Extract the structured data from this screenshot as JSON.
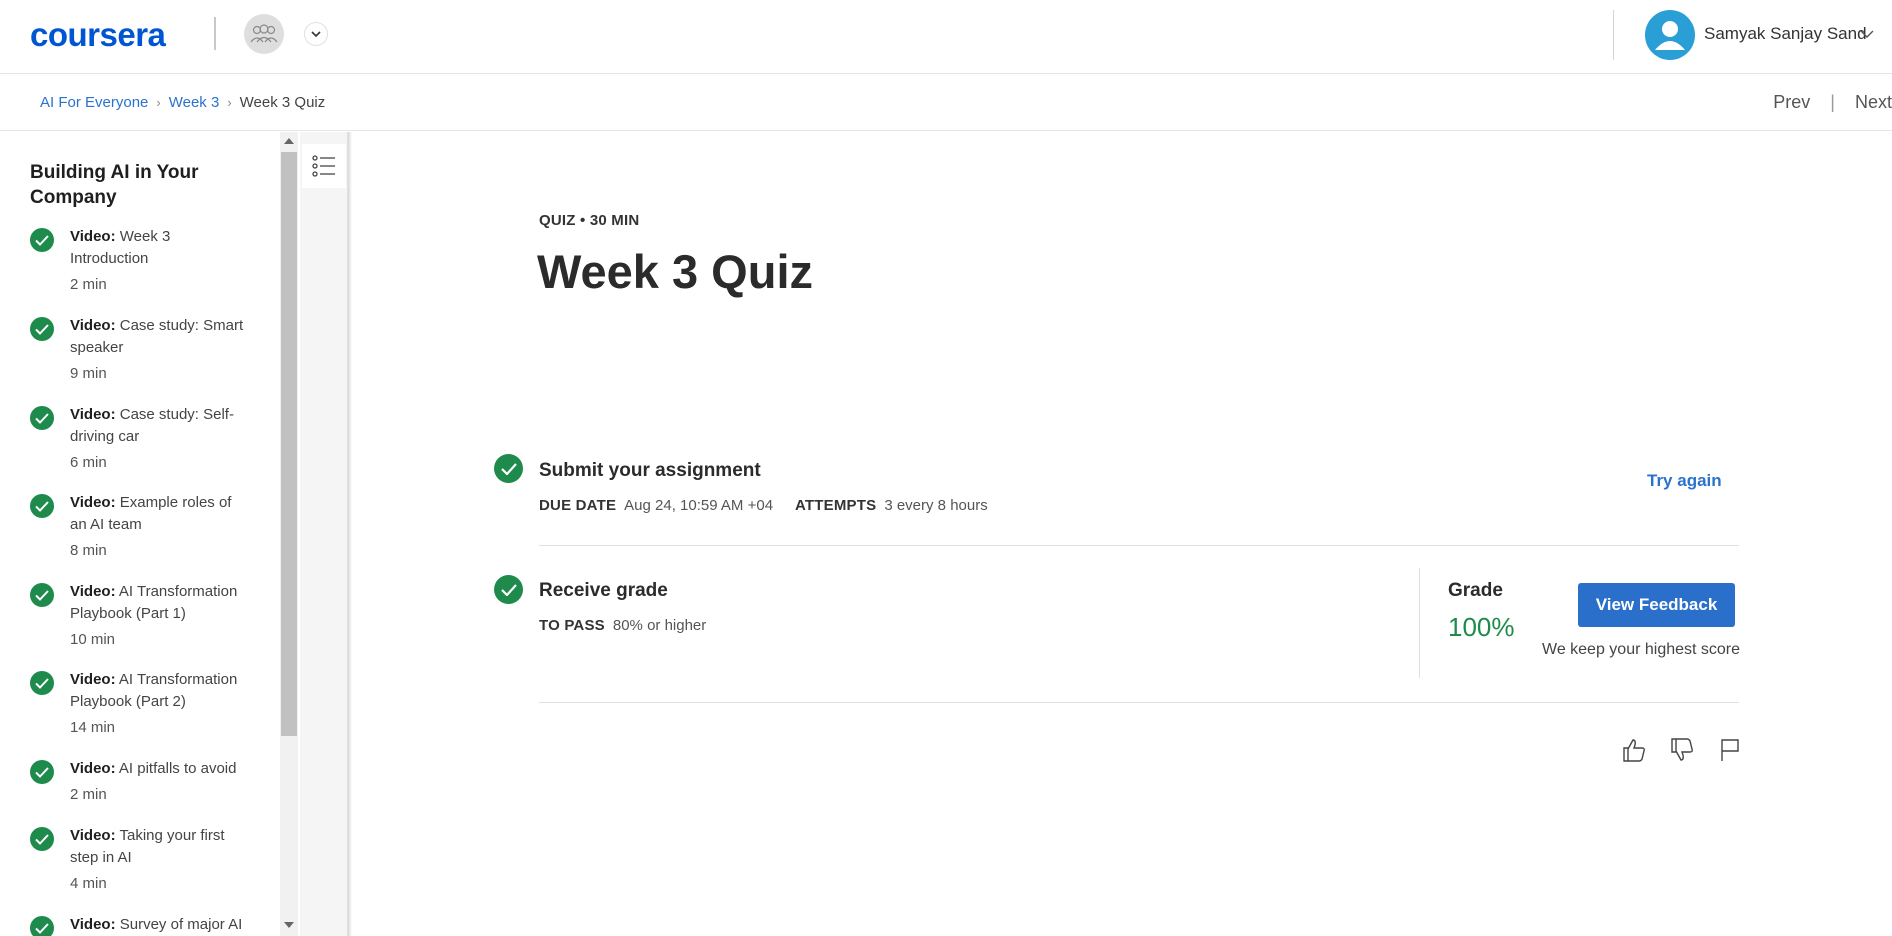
{
  "header": {
    "logo": "coursera",
    "user_name": "Samyak Sanjay Sand"
  },
  "breadcrumb": {
    "items": [
      "AI For Everyone",
      "Week 3"
    ],
    "current": "Week 3 Quiz",
    "separator": "›"
  },
  "nav": {
    "prev": "Prev",
    "next": "Next",
    "divider": "|"
  },
  "sidebar": {
    "title": "Building AI in Your Company",
    "items": [
      {
        "type": "Video:",
        "title": "Week 3 Introduction",
        "duration": "2 min"
      },
      {
        "type": "Video:",
        "title": "Case study: Smart speaker",
        "duration": "9 min"
      },
      {
        "type": "Video:",
        "title": "Case study: Self-driving car",
        "duration": "6 min"
      },
      {
        "type": "Video:",
        "title": "Example roles of an AI team",
        "duration": "8 min"
      },
      {
        "type": "Video:",
        "title": "AI Transformation Playbook (Part 1)",
        "duration": "10 min"
      },
      {
        "type": "Video:",
        "title": "AI Transformation Playbook (Part 2)",
        "duration": "14 min"
      },
      {
        "type": "Video:",
        "title": "AI pitfalls to avoid",
        "duration": "2 min"
      },
      {
        "type": "Video:",
        "title": "Taking your first step in AI",
        "duration": "4 min"
      },
      {
        "type": "Video:",
        "title": "Survey of major AI",
        "duration": ""
      }
    ]
  },
  "main": {
    "meta": "QUIZ • 30 MIN",
    "title": "Week 3 Quiz",
    "submit": {
      "title": "Submit your assignment",
      "due_label": "DUE DATE",
      "due_value": "Aug 24, 10:59 AM +04",
      "attempts_label": "ATTEMPTS",
      "attempts_value": "3 every 8 hours",
      "action": "Try again"
    },
    "grade": {
      "title": "Receive grade",
      "pass_label": "TO PASS",
      "pass_value": "80% or higher",
      "grade_label": "Grade",
      "grade_value": "100%",
      "button": "View Feedback",
      "note": "We keep your highest score"
    }
  },
  "colors": {
    "brand": "#0056d2",
    "success": "#1e8a4c",
    "link": "#2a73cc",
    "button": "#2a6fc9"
  },
  "icons": [
    "team-icon",
    "chevron-down-icon",
    "user-icon",
    "list-icon",
    "check-icon",
    "thumbs-up-icon",
    "thumbs-down-icon",
    "flag-icon"
  ]
}
